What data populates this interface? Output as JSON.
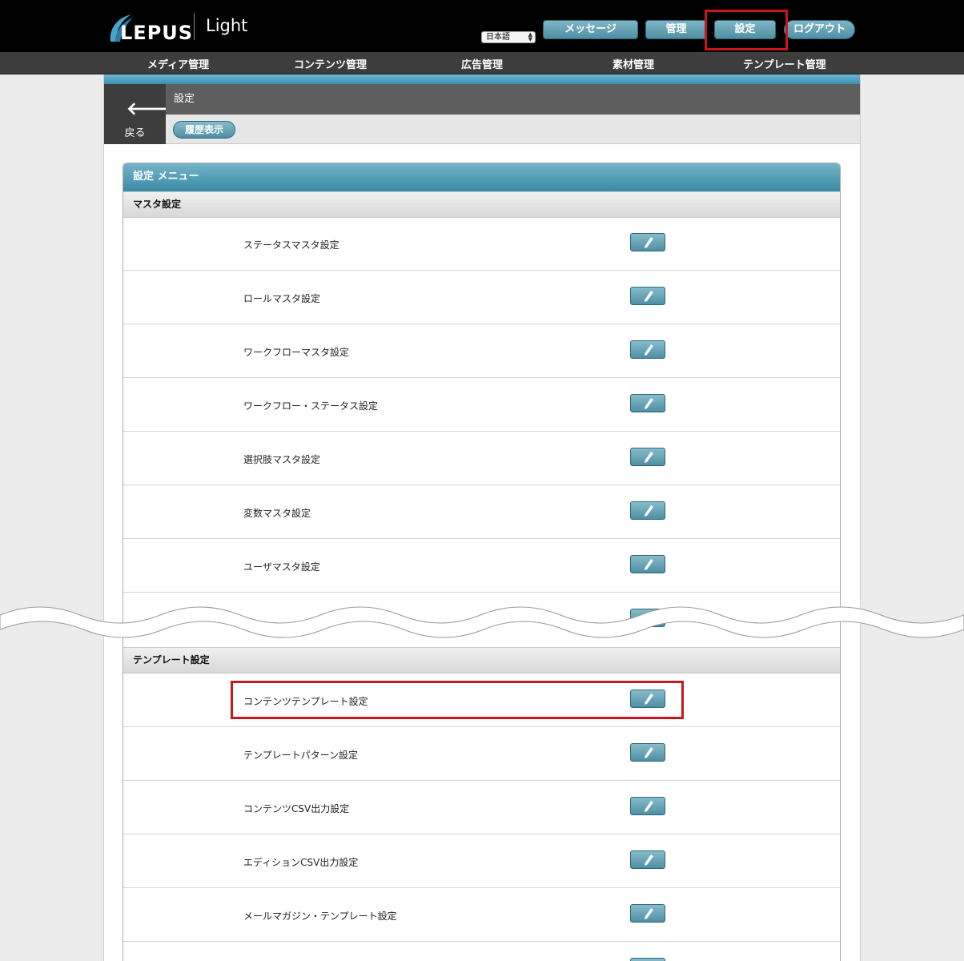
{
  "header": {
    "logo_text": "LEPUS",
    "product_name": "Light",
    "language_select": "日本語",
    "buttons": {
      "message": "メッセージ",
      "admin": "管理",
      "settings": "設定",
      "logout": "ログアウト"
    }
  },
  "nav": [
    {
      "label": "メディア管理"
    },
    {
      "label": "コンテンツ管理"
    },
    {
      "label": "広告管理"
    },
    {
      "label": "素材管理"
    },
    {
      "label": "テンプレート管理"
    }
  ],
  "page": {
    "back_label": "戻る",
    "title": "設定",
    "history_button": "履歴表示"
  },
  "panel": {
    "title": "設定 メニュー",
    "sections": [
      {
        "title": "マスタ設定",
        "items": [
          {
            "label": "ステータスマスタ設定"
          },
          {
            "label": "ロールマスタ設定"
          },
          {
            "label": "ワークフローマスタ設定"
          },
          {
            "label": "ワークフロー・ステータス設定"
          },
          {
            "label": "選択肢マスタ設定"
          },
          {
            "label": "変数マスタ設定"
          },
          {
            "label": "ユーザマスタ設定"
          }
        ]
      },
      {
        "title": "テンプレート設定",
        "items": [
          {
            "label": "コンテンツテンプレート設定"
          },
          {
            "label": "テンプレートパターン設定"
          },
          {
            "label": "コンテンツCSV出力設定"
          },
          {
            "label": "エディションCSV出力設定"
          },
          {
            "label": "メールマガジン・テンプレート設定"
          }
        ]
      }
    ]
  },
  "colors": {
    "accent": "#4f8fa3",
    "highlight": "#c8161e",
    "header_bg": "#000000",
    "nav_bg": "#3d3d3d"
  },
  "icons": {
    "edit": "pencil-icon",
    "back": "arrow-left-icon"
  }
}
